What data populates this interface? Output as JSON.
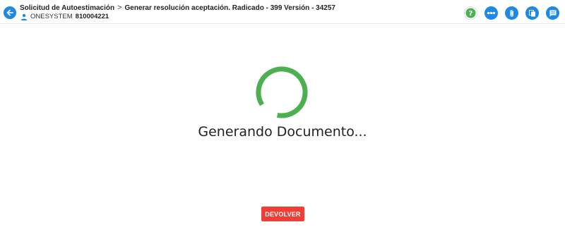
{
  "header": {
    "breadcrumb": [
      "Solicitud de Autoestimación",
      "Generar resolución aceptación. Radicado - 399 Versión - 34257"
    ],
    "breadcrumb_separator": ">",
    "user_name": "ONESYSTEM",
    "user_id": "810004221"
  },
  "actions": [
    {
      "name": "help-icon"
    },
    {
      "name": "workflow-icon"
    },
    {
      "name": "attachment-icon"
    },
    {
      "name": "copy-icon"
    },
    {
      "name": "comments-icon"
    }
  ],
  "main": {
    "status_text": "Generando Documento..."
  },
  "footer": {
    "return_label": "DEVOLVER"
  },
  "colors": {
    "primary": "#1e88e5",
    "spinner": "#4caf50",
    "danger": "#ef3e36",
    "help": "#4caf50"
  }
}
